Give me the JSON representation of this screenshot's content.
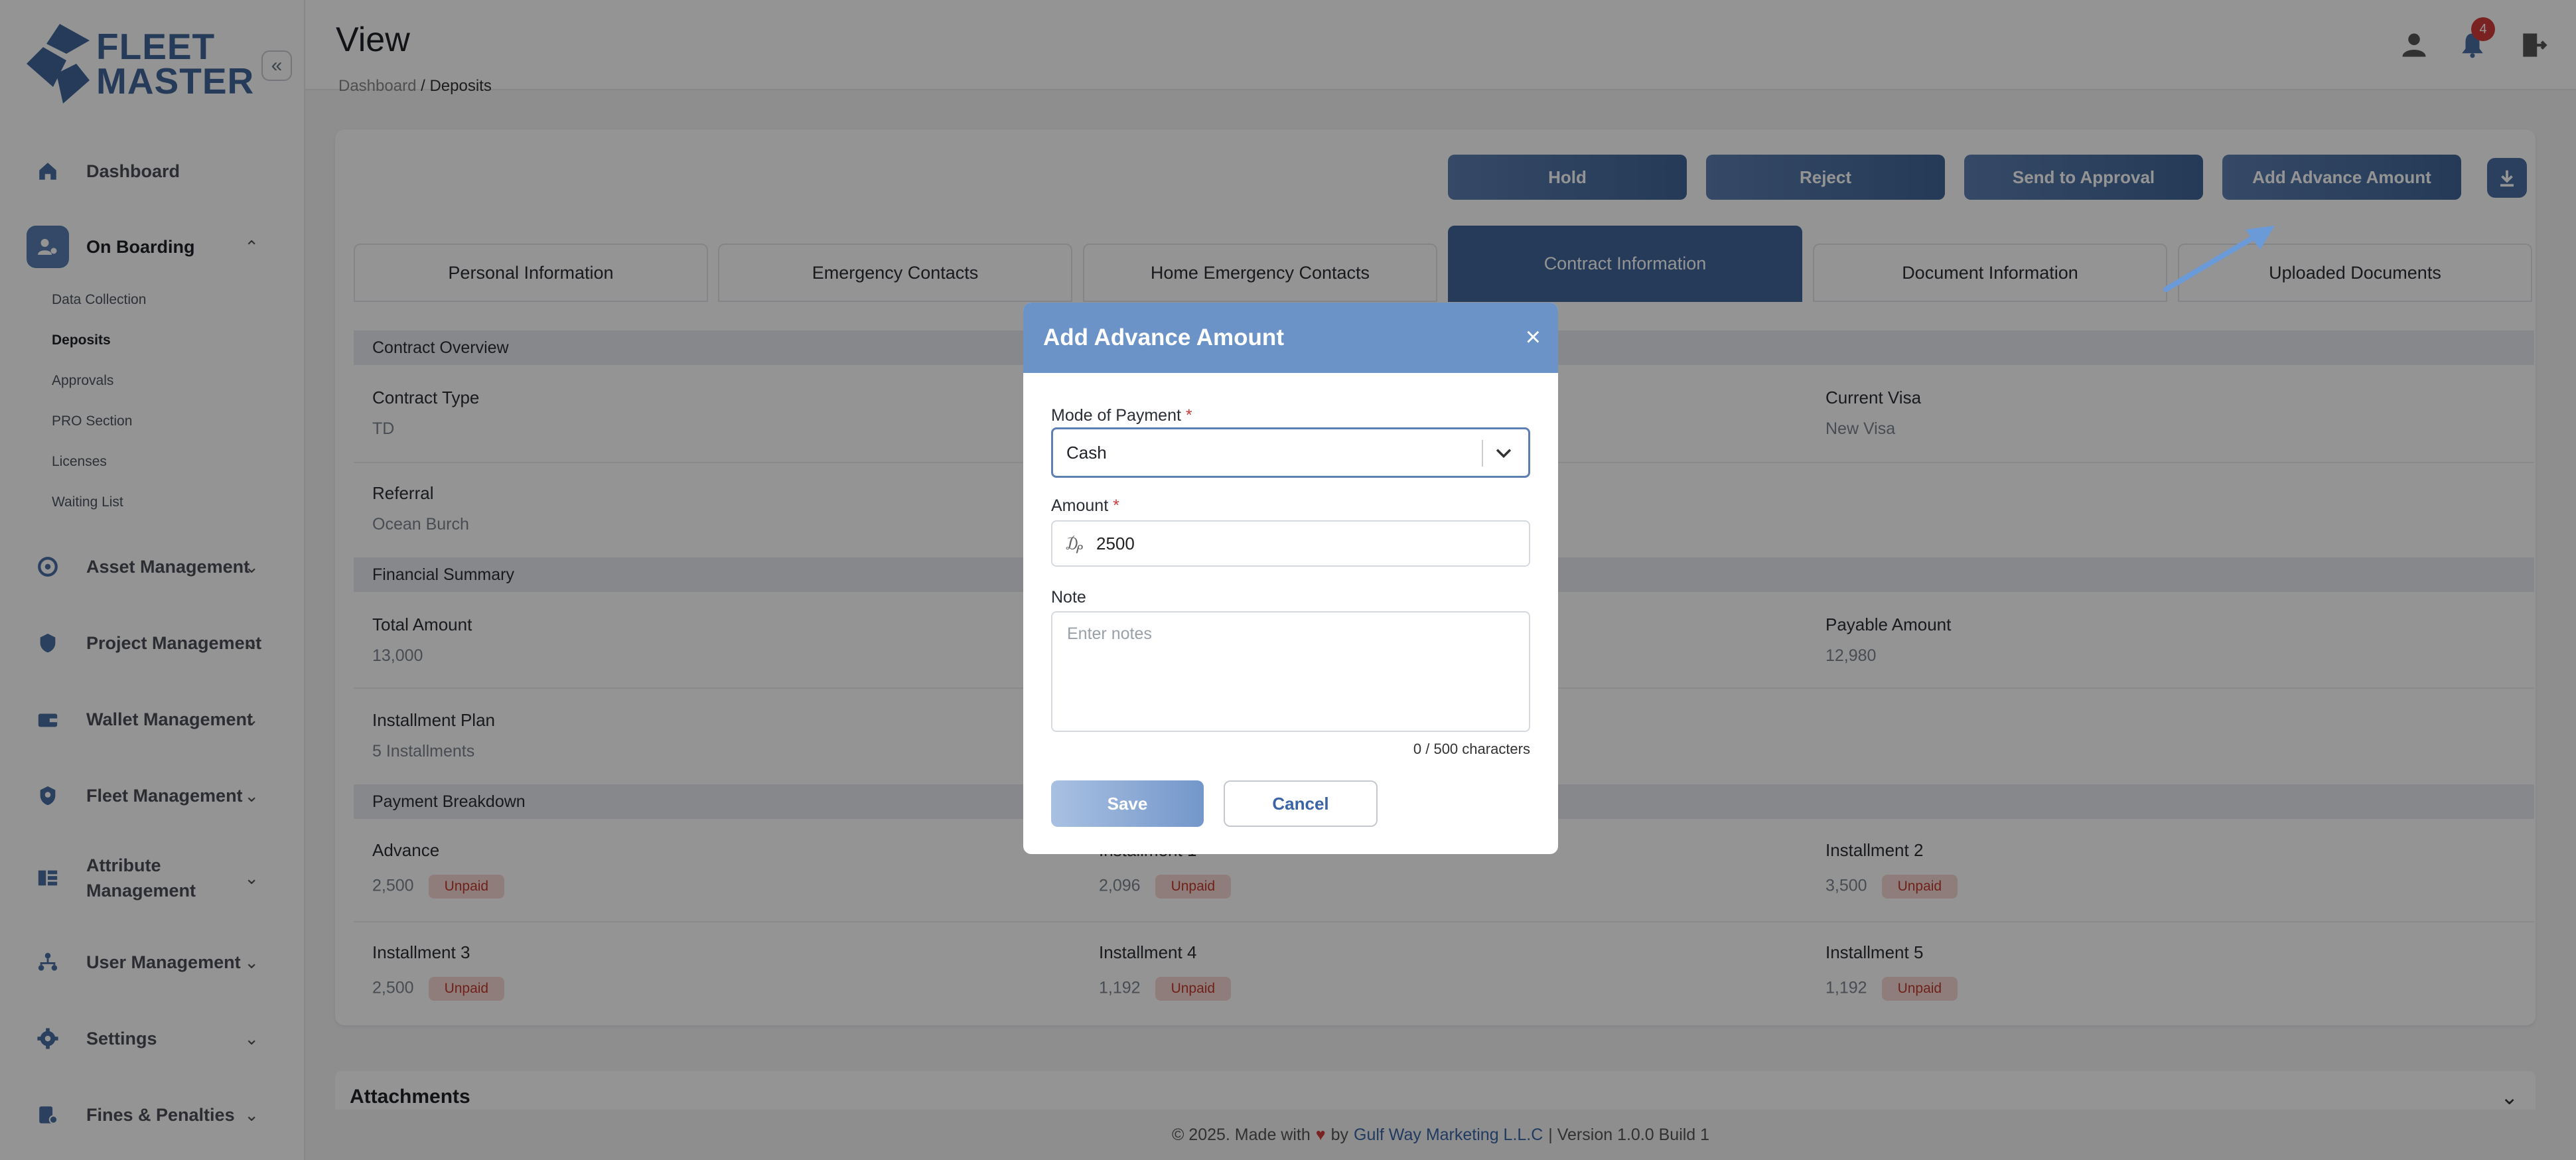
{
  "app": {
    "logo_line1": "FLEET",
    "logo_line2": "MASTER",
    "collapse_icon": "double-chevron-left-icon"
  },
  "header": {
    "title": "View",
    "notification_count": "4"
  },
  "breadcrumb": {
    "items": [
      "Dashboard",
      "Deposits"
    ]
  },
  "sidebar": {
    "items": [
      {
        "label": "Dashboard",
        "icon": "home-icon"
      },
      {
        "label": "On Boarding",
        "icon": "onboarding-icon",
        "active": true
      },
      {
        "label": "Asset Management",
        "icon": "asset-icon"
      },
      {
        "label": "Project Management",
        "icon": "project-icon"
      },
      {
        "label": "Wallet Management",
        "icon": "wallet-icon"
      },
      {
        "label": "Fleet Management",
        "icon": "fleet-icon"
      },
      {
        "label": "Attribute Management",
        "icon": "attribute-icon"
      },
      {
        "label": "User Management",
        "icon": "users-icon"
      },
      {
        "label": "Settings",
        "icon": "gear-icon"
      },
      {
        "label": "Fines & Penalties",
        "icon": "fines-icon"
      }
    ],
    "subitems": [
      "Data Collection",
      "Deposits",
      "Approvals",
      "PRO Section",
      "Licenses",
      "Waiting List"
    ]
  },
  "actions": {
    "hold": "Hold",
    "reject": "Reject",
    "send": "Send to Approval",
    "add_advance": "Add Advance Amount"
  },
  "tabs": [
    "Personal Information",
    "Emergency Contacts",
    "Home Emergency Contacts",
    "Contract Information",
    "Document Information",
    "Uploaded Documents"
  ],
  "contract": {
    "overview_title": "Contract Overview",
    "contract_type_label": "Contract Type",
    "contract_type": "TD",
    "current_visa_label": "Current Visa",
    "current_visa": "New Visa",
    "referral_label": "Referral",
    "referral": "Ocean Burch",
    "financial_title": "Financial Summary",
    "total_label": "Total Amount",
    "total": "13,000",
    "payable_label": "Payable Amount",
    "payable": "12,980",
    "plan_label": "Installment Plan",
    "plan": "5 Installments",
    "breakdown_title": "Payment Breakdown",
    "unpaid": "Unpaid",
    "advance_label": "Advance",
    "advance": "2,500",
    "inst1_label": "Installment 1",
    "inst1": "2,096",
    "inst2_label": "Installment 2",
    "inst2": "3,500",
    "inst3_label": "Installment 3",
    "inst3": "2,500",
    "inst4_label": "Installment 4",
    "inst4": "1,192",
    "inst5_label": "Installment 5",
    "inst5": "1,192"
  },
  "attachments": {
    "title": "Attachments"
  },
  "footer": {
    "prefix": "© 2025. Made with",
    "by": "by",
    "company": "Gulf Way Marketing L.L.C",
    "version": "| Version 1.0.0 Build 1"
  },
  "modal": {
    "title": "Add Advance Amount",
    "mode_label": "Mode of Payment",
    "mode_value": "Cash",
    "amount_label": "Amount",
    "amount_value": "2500",
    "currency_symbol": "₯",
    "note_label": "Note",
    "note_placeholder": "Enter notes",
    "counter": "0 / 500 characters",
    "save": "Save",
    "cancel": "Cancel",
    "required_mark": "*"
  },
  "colors": {
    "brand": "#41669a",
    "modal_header": "#6b93c7",
    "unpaid_bg": "#f7d8d6",
    "unpaid_text": "#c0392b"
  }
}
